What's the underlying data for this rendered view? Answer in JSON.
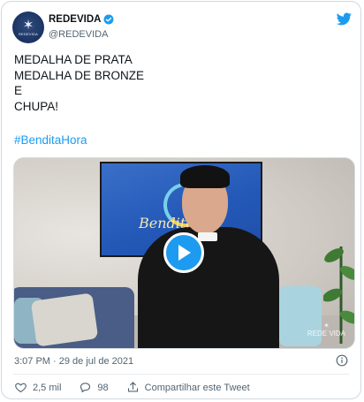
{
  "account": {
    "display_name": "REDEVIDA",
    "handle": "@REDEVIDA",
    "avatar_text": "REDEVIDA",
    "verified": true
  },
  "tweet": {
    "lines": [
      "MEDALHA DE PRATA",
      "MEDALHA DE BRONZE",
      "E",
      "CHUPA!"
    ],
    "hashtag": "#BenditaHora",
    "timestamp": "3:07 PM · 29 de jul de 2021"
  },
  "media": {
    "screen_title": "Bendita",
    "watermark_bottom_right": "REDE VIDA"
  },
  "actions": {
    "likes": "2,5 mil",
    "replies": "98",
    "share_label": "Compartilhar este Tweet"
  },
  "colors": {
    "accent": "#1d9bf0",
    "text": "#0f1419",
    "muted": "#536471",
    "border": "#cfd9de"
  },
  "icons": [
    "verified-badge-icon",
    "twitter-bird-icon",
    "play-icon",
    "info-icon",
    "heart-icon",
    "reply-icon",
    "share-icon"
  ]
}
